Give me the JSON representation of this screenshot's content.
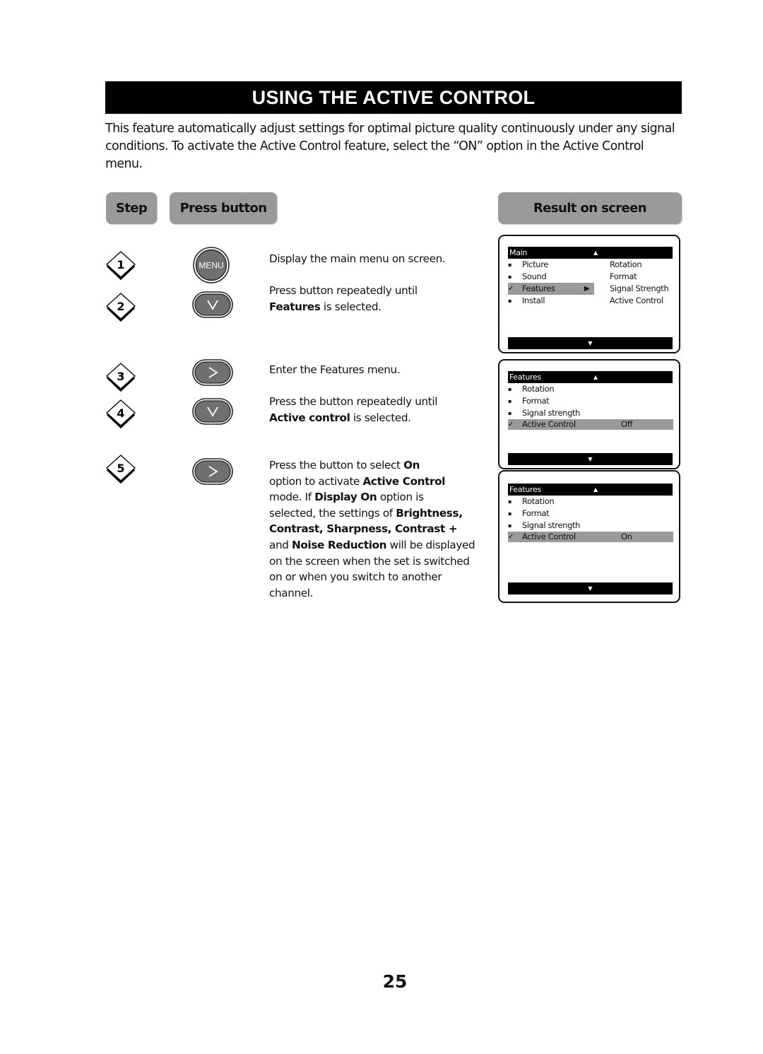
{
  "title": "USING THE ACTIVE CONTROL",
  "intro": "This feature automatically adjust settings for optimal picture quality continuously under any signal conditions. To activate the Active Control feature, select the “ON” option in the Active Control menu.",
  "headers": {
    "step": "Step",
    "press_button": "Press button",
    "result": "Result on screen"
  },
  "steps": [
    {
      "number": "1",
      "button": {
        "icon": "menu-button",
        "label": "MENU"
      }
    },
    {
      "number": "2",
      "button": {
        "icon": "down-button",
        "label": "∨"
      }
    },
    {
      "number": "3",
      "button": {
        "icon": "right-button",
        "label": ">"
      }
    },
    {
      "number": "4",
      "button": {
        "icon": "down-button",
        "label": "∨"
      }
    },
    {
      "number": "5",
      "button": {
        "icon": "right-button",
        "label": ">"
      }
    }
  ],
  "descriptions": {
    "d1": "Display the main menu on screen.",
    "d2_a": "Press button repeatedly until",
    "d2_b": "Features",
    "d2_c": " is selected.",
    "d3": "Enter the Features menu.",
    "d4_a": "Press the button repeatedly until",
    "d4_b": "Active control",
    "d4_c": " is selected.",
    "d5": [
      {
        "t": "Press the button to select ",
        "b": false
      },
      {
        "t": "On",
        "b": true
      },
      {
        "t": "\n",
        "b": false
      },
      {
        "t": "option to activate ",
        "b": false
      },
      {
        "t": "Active Control",
        "b": true
      },
      {
        "t": "\n",
        "b": false
      },
      {
        "t": "mode. If ",
        "b": false
      },
      {
        "t": "Display On",
        "b": true
      },
      {
        "t": " option is",
        "b": false
      },
      {
        "t": "\n",
        "b": false
      },
      {
        "t": "selected, the settings of ",
        "b": false
      },
      {
        "t": "Brightness,",
        "b": true
      },
      {
        "t": "\n",
        "b": false
      },
      {
        "t": "Contrast, Sharpness, Contrast +",
        "b": true
      },
      {
        "t": "\n",
        "b": false
      },
      {
        "t": "and ",
        "b": false
      },
      {
        "t": "Noise Reduction",
        "b": true
      },
      {
        "t": " will be displayed",
        "b": false
      },
      {
        "t": "\n",
        "b": false
      },
      {
        "t": "on the screen when the set is switched",
        "b": false
      },
      {
        "t": "\n",
        "b": false
      },
      {
        "t": "on or when you switch to another",
        "b": false
      },
      {
        "t": "\n",
        "b": false
      },
      {
        "t": "channel.",
        "b": false
      }
    ]
  },
  "screens": {
    "main": {
      "title": "Main",
      "up": "▲",
      "down": "▼",
      "items": [
        {
          "marker": "▪",
          "label": "Picture",
          "selected": false
        },
        {
          "marker": "▪",
          "label": "Sound",
          "selected": false
        },
        {
          "marker": "✓",
          "label": "Features",
          "selected": true,
          "arrow": "▶"
        },
        {
          "marker": "▪",
          "label": "Install",
          "selected": false
        }
      ],
      "submenu": [
        "Rotation",
        "Format",
        "Signal Strength",
        "Active Control"
      ]
    },
    "features_off": {
      "title": "Features",
      "up": "▲",
      "down": "▼",
      "items": [
        {
          "marker": "▪",
          "label": "Rotation",
          "value": ""
        },
        {
          "marker": "▪",
          "label": "Format",
          "value": ""
        },
        {
          "marker": "▪",
          "label": "Signal strength",
          "value": ""
        },
        {
          "marker": "✓",
          "label": "Active Control",
          "value": "Off",
          "selected": true
        }
      ]
    },
    "features_on": {
      "title": "Features",
      "up": "▲",
      "down": "▼",
      "items": [
        {
          "marker": "▪",
          "label": "Rotation",
          "value": ""
        },
        {
          "marker": "▪",
          "label": "Format",
          "value": ""
        },
        {
          "marker": "▪",
          "label": "Signal strength",
          "value": ""
        },
        {
          "marker": "✓",
          "label": "Active Control",
          "value": "On",
          "selected": true
        }
      ]
    }
  },
  "colors": {
    "header_bg": "#9a9a9a",
    "button_fill": "#707070",
    "highlight": "#9a9a9a"
  },
  "page_number": "25"
}
